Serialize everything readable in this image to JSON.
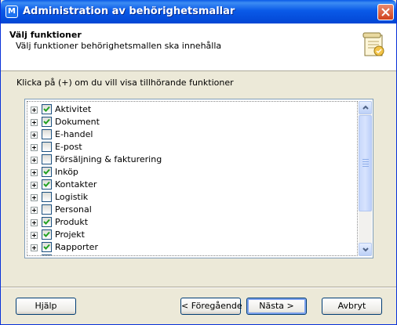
{
  "window": {
    "title": "Administration av behörighetsmallar"
  },
  "header": {
    "title": "Välj funktioner",
    "subtitle": "Välj funktioner behörighetsmallen ska innehålla"
  },
  "instruction": "Klicka på (+) om du vill visa tillhörande funktioner",
  "functions": [
    {
      "label": "Aktivitet",
      "checked": true
    },
    {
      "label": "Dokument",
      "checked": true
    },
    {
      "label": "E-handel",
      "checked": false
    },
    {
      "label": "E-post",
      "checked": false
    },
    {
      "label": "Försäljning & fakturering",
      "checked": false
    },
    {
      "label": "Inköp",
      "checked": true
    },
    {
      "label": "Kontakter",
      "checked": true
    },
    {
      "label": "Logistik",
      "checked": false
    },
    {
      "label": "Personal",
      "checked": false
    },
    {
      "label": "Produkt",
      "checked": true
    },
    {
      "label": "Projekt",
      "checked": true
    },
    {
      "label": "Rapporter",
      "checked": true
    },
    {
      "label": "Redovisning",
      "checked": false
    }
  ],
  "buttons": {
    "help": "Hjälp",
    "previous": "< Föregående",
    "next": "Nästa >",
    "cancel": "Avbryt"
  },
  "colors": {
    "titlebar": "#0a5ae8",
    "dialog_bg": "#ece9d8",
    "close": "#d0411c"
  }
}
